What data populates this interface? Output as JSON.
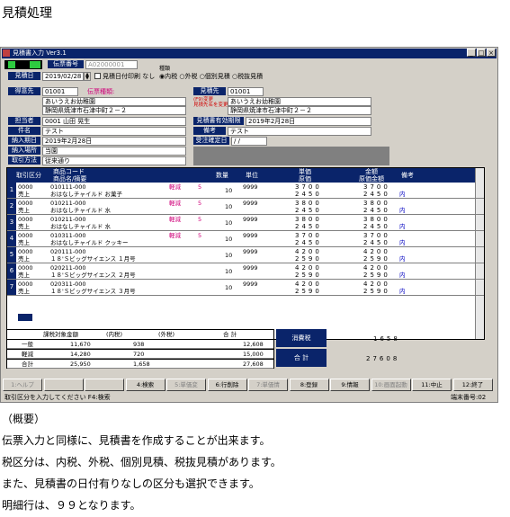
{
  "page_title": "見積処理",
  "window": {
    "title": "見積書入力 Ver3.1"
  },
  "header": {
    "denpyo_label": "伝票番号",
    "denpyo_no": "A02000001",
    "mitsumoribi_label": "見積日",
    "mitsumoribi": "2019/02/28",
    "hizuke_check": "見積日付印刷 なし",
    "zei_label": "種類",
    "zei_options": [
      "内税",
      "外税",
      "個別見積",
      "税抜見積"
    ],
    "tokuisaki_label": "得意先",
    "tokuisaki_code": "01001",
    "denpyo_label2": "伝票種類:",
    "tokuisaki_name": "あいうえお幼稚園",
    "tokuisaki_addr": "静岡県焼津市石津中町２－２",
    "nouhinsaki_label": "見積先",
    "nouhinsaki_code": "01001",
    "nouhinsaki_note": "(F9)変更\n見積先名を変更します",
    "nouhinsaki_name": "あいうえお幼稚園",
    "nouhinsaki_addr": "静岡県焼津市石津中町２－２",
    "tanto_label": "担当者",
    "tanto": "0001 山田 晃生",
    "yuko_label": "見積書有効期限",
    "yuko": "2019年2月28日",
    "kenmei_label": "件名",
    "kenmei": "テスト",
    "biko_label": "備考",
    "biko": "テスト",
    "nyuki_label": "納入期日",
    "nyuki": "2019年2月28日",
    "juchu_label": "受注確定日",
    "juchu": "/ /",
    "basho_label": "納入場所",
    "basho": "当園",
    "torihiki_label": "取引方法",
    "torihiki": "従来通り"
  },
  "grid": {
    "headers": {
      "kubun": "取引区分",
      "code": "商品コード",
      "name": "商品名/摘要",
      "qty": "数量",
      "unit": "単位",
      "tanka": "単価",
      "genka": "原価",
      "kingaku": "金額",
      "genka_kin": "原価金額",
      "biko": "備考"
    },
    "rows": [
      {
        "no": "1",
        "kubun_code": "0000",
        "kubun": "売上",
        "code": "010111-000",
        "name": "おはなしチャイルド お菓子",
        "tax": "軽減",
        "tax_n": "5",
        "qty": "10",
        "unit": "9999",
        "tanka": "3700",
        "genka": "2450",
        "kingaku": "3700",
        "genka_kin": "2450",
        "biko": "内"
      },
      {
        "no": "2",
        "kubun_code": "0000",
        "kubun": "売上",
        "code": "010211-000",
        "name": "おはなしチャイルド 水",
        "tax": "軽減",
        "tax_n": "5",
        "qty": "10",
        "unit": "9999",
        "tanka": "3800",
        "genka": "2450",
        "kingaku": "3800",
        "genka_kin": "2450",
        "biko": "内"
      },
      {
        "no": "3",
        "kubun_code": "0000",
        "kubun": "売上",
        "code": "010211-000",
        "name": "おはなしチャイルド 水",
        "tax": "軽減",
        "tax_n": "5",
        "qty": "10",
        "unit": "9999",
        "tanka": "3800",
        "genka": "2450",
        "kingaku": "3800",
        "genka_kin": "2450",
        "biko": "内"
      },
      {
        "no": "4",
        "kubun_code": "0000",
        "kubun": "売上",
        "code": "010311-000",
        "name": "おはなしチャイルド クッキー",
        "tax": "軽減",
        "tax_n": "5",
        "qty": "10",
        "unit": "9999",
        "tanka": "3700",
        "genka": "2450",
        "kingaku": "3700",
        "genka_kin": "2450",
        "biko": "内"
      },
      {
        "no": "5",
        "kubun_code": "0000",
        "kubun": "売上",
        "code": "020111-000",
        "name": "１８'Ｓビッグサイエンス １月号",
        "tax": "",
        "tax_n": "",
        "qty": "10",
        "unit": "9999",
        "tanka": "4200",
        "genka": "2590",
        "kingaku": "4200",
        "genka_kin": "2590",
        "biko": "内"
      },
      {
        "no": "6",
        "kubun_code": "0000",
        "kubun": "売上",
        "code": "020211-000",
        "name": "１８'Ｓビッグサイエンス ２月号",
        "tax": "",
        "tax_n": "",
        "qty": "10",
        "unit": "9999",
        "tanka": "4200",
        "genka": "2590",
        "kingaku": "4200",
        "genka_kin": "2590",
        "biko": "内"
      },
      {
        "no": "7",
        "kubun_code": "0000",
        "kubun": "売上",
        "code": "020311-000",
        "name": "１８'Ｓビッグサイエンス ３月号",
        "tax": "",
        "tax_n": "",
        "qty": "10",
        "unit": "9999",
        "tanka": "4200",
        "genka": "2590",
        "kingaku": "4200",
        "genka_kin": "2590",
        "biko": "内"
      }
    ]
  },
  "summary": {
    "h1": "課税対象金額",
    "h2": "(内税)",
    "h3": "(外税)",
    "h4": "合 計",
    "rows": [
      {
        "label": "一般",
        "a": "11,670",
        "b": "938",
        "c": "",
        "d": "12,608"
      },
      {
        "label": "軽減",
        "a": "14,280",
        "b": "720",
        "c": "",
        "d": "15,000"
      },
      {
        "label": "合計",
        "a": "25,950",
        "b": "1,658",
        "c": "",
        "d": "27,608"
      }
    ],
    "shohizei_label": "消費税",
    "shohizei": "1658",
    "gokei_label": "合 計",
    "gokei": "27608"
  },
  "fkeys": [
    "1:ヘルプ",
    "",
    "",
    "4:検索",
    "5:単価変",
    "6:行削除",
    "7:単価情",
    "8:登録",
    "9:情報",
    "10:画面起動",
    "11:中止",
    "12:終了"
  ],
  "status": {
    "left": "取引区分を入力してください F4:検索",
    "right": "端末番号:02"
  },
  "notes": {
    "heading": "（概要）",
    "l1": "伝票入力と同様に、見積書を作成することが出来ます。",
    "l2": "税区分は、内税、外税、個別見積、税抜見積があります。",
    "l3": "また、見積書の日付有りなしの区分も選択できます。",
    "l4": "明細行は、９９となります。"
  }
}
